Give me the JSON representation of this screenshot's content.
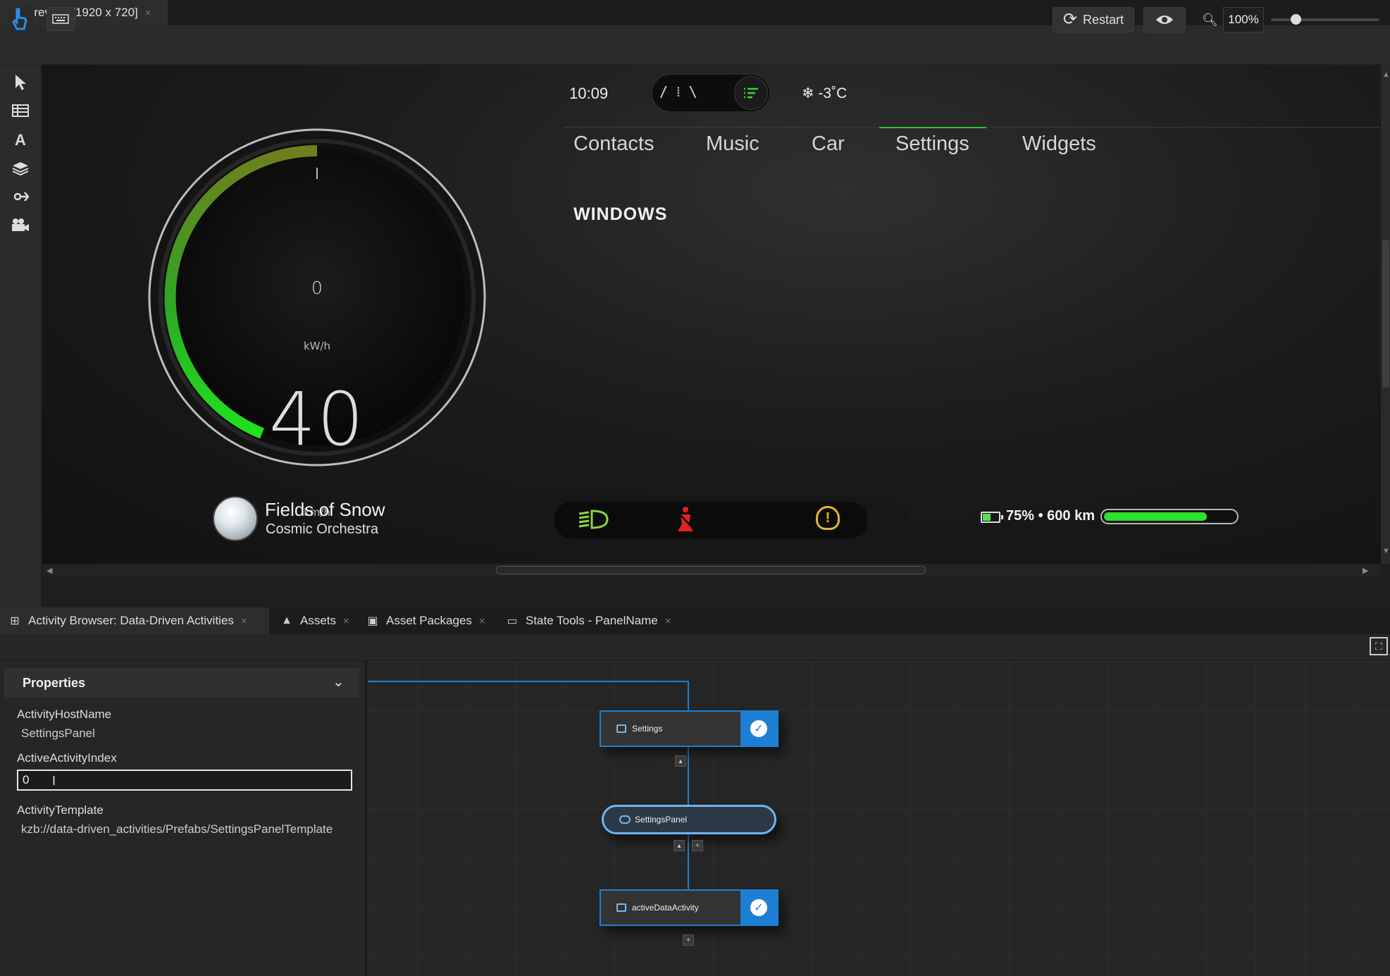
{
  "preview_tab": {
    "title": "Preview [1920 x 720]",
    "close": "×"
  },
  "toolbar": {
    "restart_label": "Restart",
    "restart_icon": "refresh-icon",
    "zoom": "100%",
    "zoom_level_percent": 100
  },
  "left_tools": [
    "select-arrow-icon",
    "table-icon",
    "text-tool-icon",
    "layers-icon",
    "binding-icon",
    "camera-icon"
  ],
  "hmi": {
    "clock": "10:09",
    "temperature": "❄ -3˚C",
    "nav": [
      "Contacts",
      "Music",
      "Car",
      "Settings",
      "Widgets"
    ],
    "active_nav": "Settings",
    "section_heading": "WINDOWS",
    "gauge": {
      "power_value": "0",
      "power_unit": "kW/h",
      "speed_value": "40",
      "speed_unit": "km/h"
    },
    "media": {
      "title": "Fields of Snow",
      "artist": "Cosmic Orchestra"
    },
    "battery": {
      "text": "75% • 600 km",
      "level_percent": 75
    },
    "colors": {
      "accent_green": "#2fe02f",
      "warning_red": "#e02424",
      "warning_amber": "#e2b72c"
    }
  },
  "bottom_tabs": [
    {
      "label": "Activity Browser: Data-Driven Activities",
      "close": "×"
    },
    {
      "label": "Assets",
      "close": "×"
    },
    {
      "label": "Asset Packages",
      "close": "×"
    },
    {
      "label": "State Tools - PanelName",
      "close": "×"
    }
  ],
  "properties": {
    "header": "Properties",
    "host_label": "ActivityHostName",
    "host_value": "SettingsPanel",
    "index_label": "ActiveActivityIndex",
    "index_value": "0",
    "template_label": "ActivityTemplate",
    "template_value": "kzb://data-driven_activities/Prefabs/SettingsPanelTemplate"
  },
  "graph": {
    "node_settings": "Settings",
    "node_panel": "SettingsPanel",
    "node_active": "activeDataActivity",
    "wire_color": "#1d7fd4"
  }
}
